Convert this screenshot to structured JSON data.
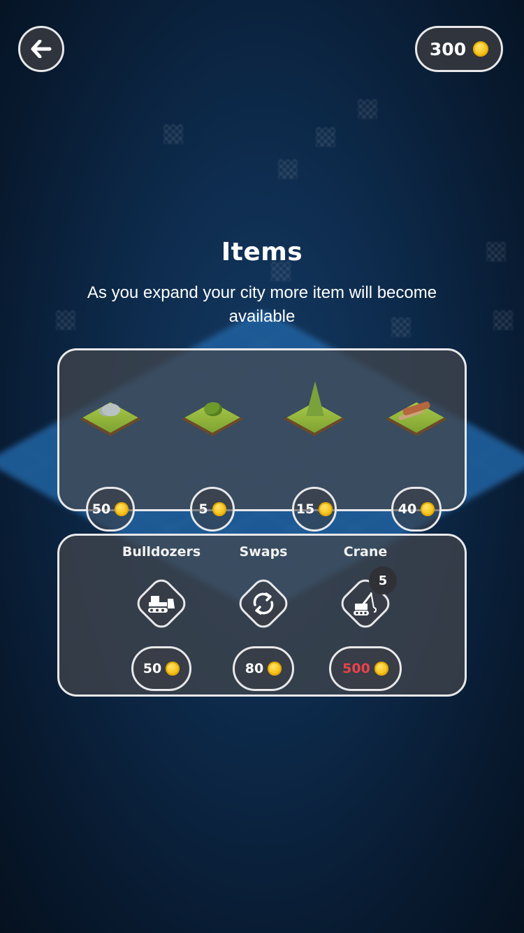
{
  "header": {
    "coins": "300"
  },
  "title": "Items",
  "subtitle": "As you expand your city more item will become available",
  "items": [
    {
      "icon": "rock-tile-icon",
      "price": "50"
    },
    {
      "icon": "bush-tile-icon",
      "price": "5"
    },
    {
      "icon": "tree-tile-icon",
      "price": "15"
    },
    {
      "icon": "logs-tile-icon",
      "price": "40"
    }
  ],
  "tools": [
    {
      "label": "Bulldozers",
      "icon": "bulldozer-icon",
      "price": "50"
    },
    {
      "label": "Swaps",
      "icon": "swap-icon",
      "price": "80"
    },
    {
      "label": "Crane",
      "icon": "crane-icon",
      "price": "500",
      "count": "5",
      "price_color": "#e8434b"
    }
  ],
  "colors": {
    "accent_coin": "#f6c21e",
    "unaffordable": "#e8434b",
    "panel_border": "#e8e8ea"
  }
}
